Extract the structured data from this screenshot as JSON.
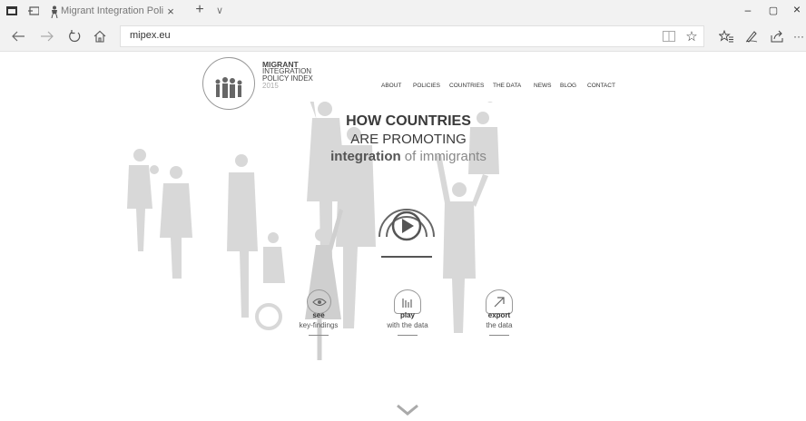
{
  "browser": {
    "tab_title": "Migrant Integration Poli",
    "url": "mipex.eu",
    "new_tab_symbol": "+",
    "tab_menu_symbol": "∨",
    "window_controls": {
      "minimize": "–",
      "restore": "▢",
      "close": "×"
    }
  },
  "site": {
    "logo_lines": [
      "MIGRANT",
      "INTEGRATION",
      "POLICY INDEX",
      "2015"
    ],
    "nav": [
      "ABOUT",
      "POLICIES",
      "COUNTRIES",
      "THE DATA",
      "NEWS",
      "BLOG",
      "CONTACT"
    ]
  },
  "hero": {
    "line1": "HOW COUNTRIES",
    "line2": "ARE PROMOTING",
    "line3_bold": "integration",
    "line3_rest": " of immigrants"
  },
  "actions": [
    {
      "title": "see",
      "subtitle": "key-findings",
      "icon": "eye-icon"
    },
    {
      "title": "play",
      "subtitle": "with the data",
      "icon": "bar-chart-icon"
    },
    {
      "title": "export",
      "subtitle": "the data",
      "icon": "arrow-up-right-icon"
    }
  ],
  "colors": {
    "chrome_bg": "#f2f2f2",
    "silhouette": "#d7d7d7",
    "text_dark": "#333333"
  }
}
